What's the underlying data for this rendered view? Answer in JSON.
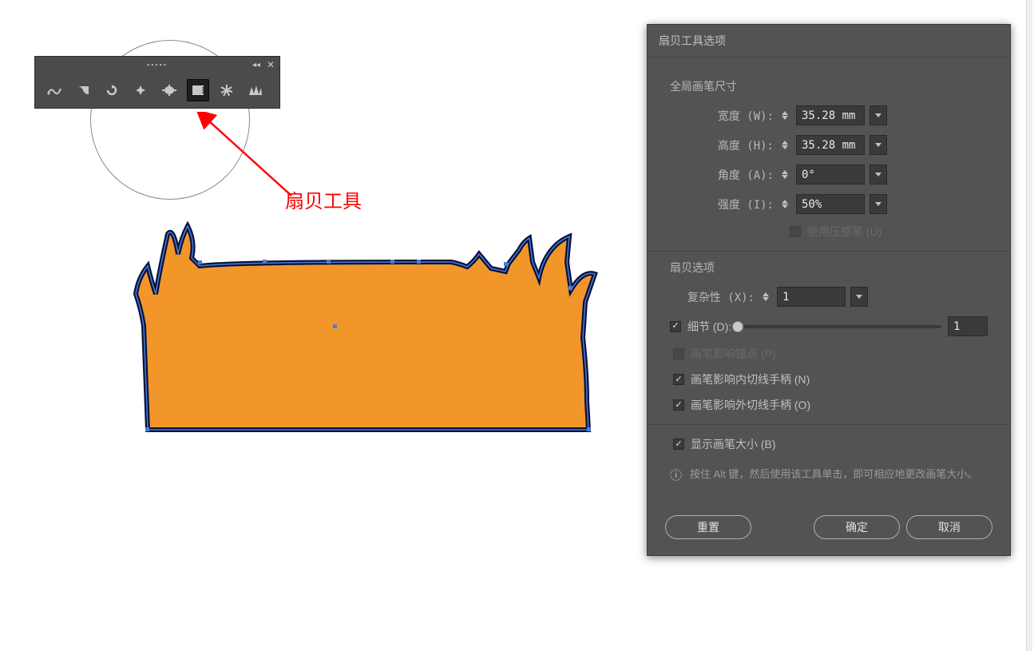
{
  "toolbar": {
    "tools": [
      "warp",
      "twirl-ccw",
      "twirl-cw",
      "pucker",
      "bloat",
      "scallop",
      "crystallize",
      "wrinkle"
    ],
    "selected_index": 5
  },
  "annotation": {
    "tool_label": "扇贝工具"
  },
  "dialog": {
    "title": "扇贝工具选项",
    "global_section": {
      "label": "全局画笔尺寸",
      "width_label": "宽度 (W):",
      "height_label": "高度 (H):",
      "angle_label": "角度 (A):",
      "intensity_label": "强度 (I):",
      "width_value": "35.28 mm",
      "height_value": "35.28 mm",
      "angle_value": "0°",
      "intensity_value": "50%",
      "pressure_label": "使用压感笔 (U)"
    },
    "scallop_section": {
      "label": "扇贝选项",
      "complexity_label": "复杂性 (X):",
      "complexity_value": "1",
      "detail_label": "细节 (D):",
      "detail_value": "1",
      "anchor_label": "画笔影响锚点 (P)",
      "in_tangent_label": "画笔影响内切线手柄 (N)",
      "out_tangent_label": "画笔影响外切线手柄 (O)"
    },
    "show_brush_label": "显示画笔大小 (B)",
    "info": "按住 Alt 键，然后使用该工具单击，即可相应地更改画笔大小。",
    "buttons": {
      "reset": "重置",
      "ok": "确定",
      "cancel": "取消"
    }
  }
}
